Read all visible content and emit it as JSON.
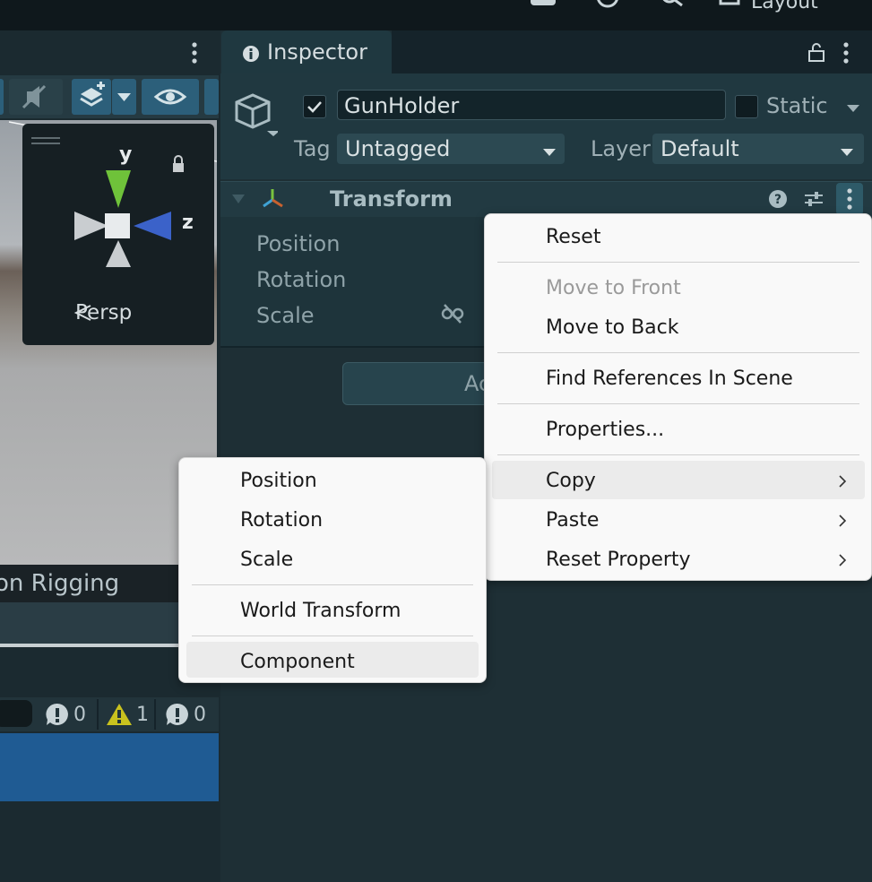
{
  "top_bar": {
    "layout_label": "Layout"
  },
  "scene_view": {
    "gizmo": {
      "y_label": "y",
      "z_label": "z",
      "persp_label": "Persp"
    },
    "rigging_label": "on Rigging"
  },
  "console": {
    "counts": {
      "info": "0",
      "warning": "1",
      "error": "0"
    }
  },
  "inspector": {
    "tab_label": "Inspector",
    "object": {
      "active": true,
      "name": "GunHolder",
      "static_label": "Static",
      "static": false,
      "tag_label": "Tag",
      "tag_value": "Untagged",
      "layer_label": "Layer",
      "layer_value": "Default"
    },
    "transform": {
      "title": "Transform",
      "properties": [
        "Position",
        "Rotation",
        "Scale"
      ]
    },
    "add_component_partial": "Ac"
  },
  "context_menu": {
    "items": {
      "reset": "Reset",
      "move_to_front": "Move to Front",
      "move_to_back": "Move to Back",
      "find_references": "Find References In Scene",
      "properties": "Properties...",
      "copy": "Copy",
      "paste": "Paste",
      "reset_property": "Reset Property"
    },
    "disabled": [
      "Move to Front"
    ],
    "highlighted": "Copy"
  },
  "copy_submenu": {
    "items": {
      "position": "Position",
      "rotation": "Rotation",
      "scale": "Scale",
      "world_transform": "World Transform",
      "component": "Component"
    },
    "highlighted": "Component"
  },
  "colors": {
    "inspector_bg": "#1e2f35",
    "selection_blue": "#1f5b93",
    "accent_button": "#2c5f7a",
    "menu_bg": "#f9f9f9",
    "warning_yellow": "#c9c21e"
  }
}
